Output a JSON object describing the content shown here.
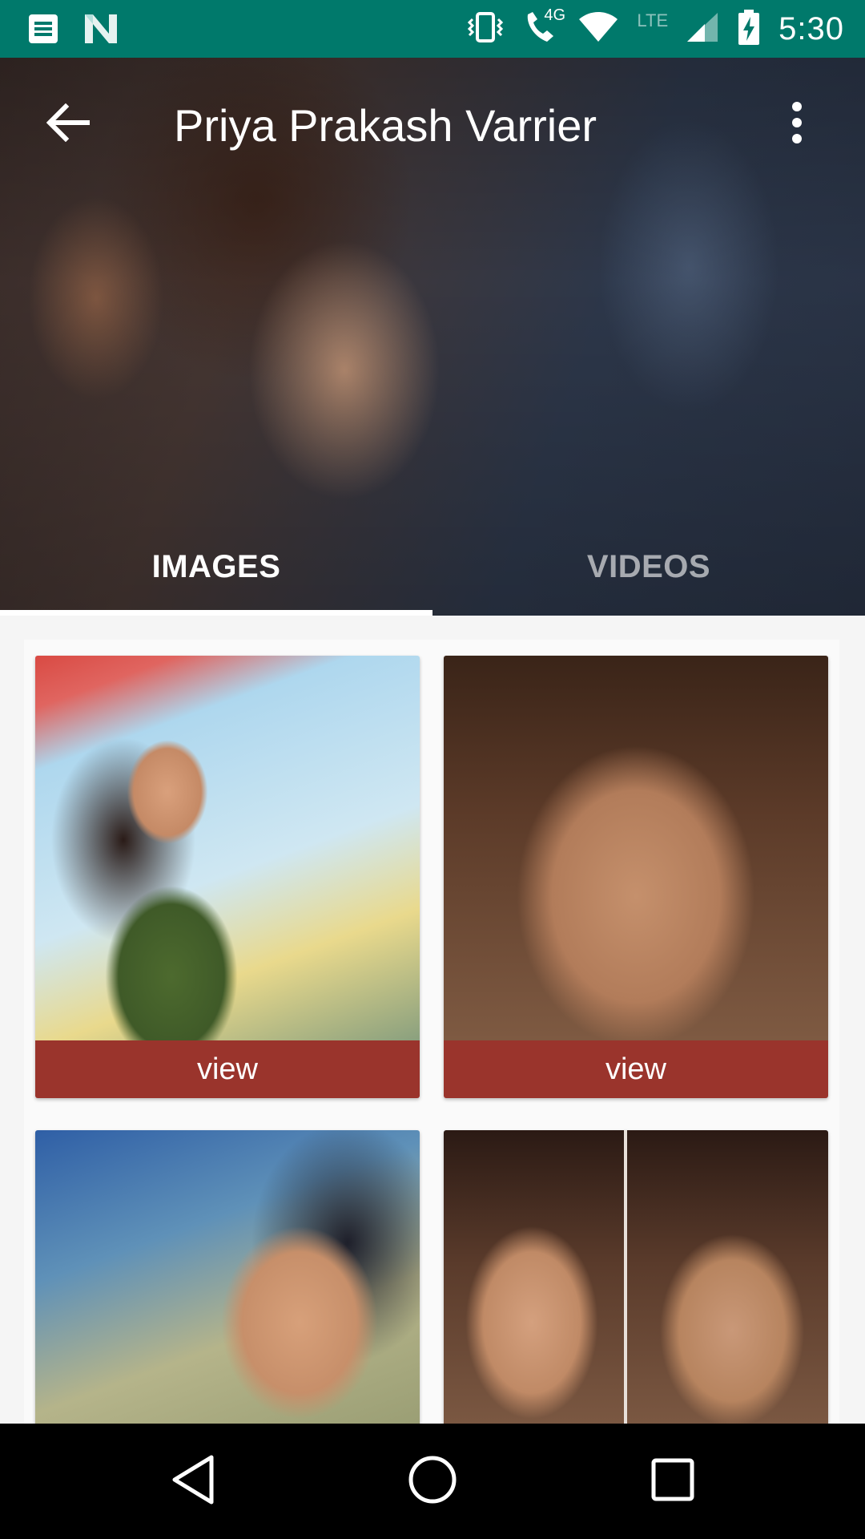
{
  "status_bar": {
    "time": "5:30",
    "network_label": "LTE",
    "data_label": "4G",
    "icons": [
      "notes-icon",
      "n-logo-icon",
      "vibrate-icon",
      "wifi-calling-icon",
      "wifi-icon",
      "signal-icon",
      "battery-charging-icon"
    ]
  },
  "toolbar": {
    "title": "Priya Prakash Varrier",
    "back_icon": "arrow-back-icon",
    "more_icon": "more-vert-icon"
  },
  "tabs": [
    {
      "label": "IMAGES",
      "selected": true
    },
    {
      "label": "VIDEOS",
      "selected": false
    }
  ],
  "grid": {
    "items": [
      {
        "button_label": "view"
      },
      {
        "button_label": "view"
      },
      {
        "button_label": ""
      },
      {
        "button_label": ""
      }
    ]
  },
  "colors": {
    "status_bar": "#00796b",
    "view_button": "#9a342c",
    "nav_bar": "#000000"
  }
}
